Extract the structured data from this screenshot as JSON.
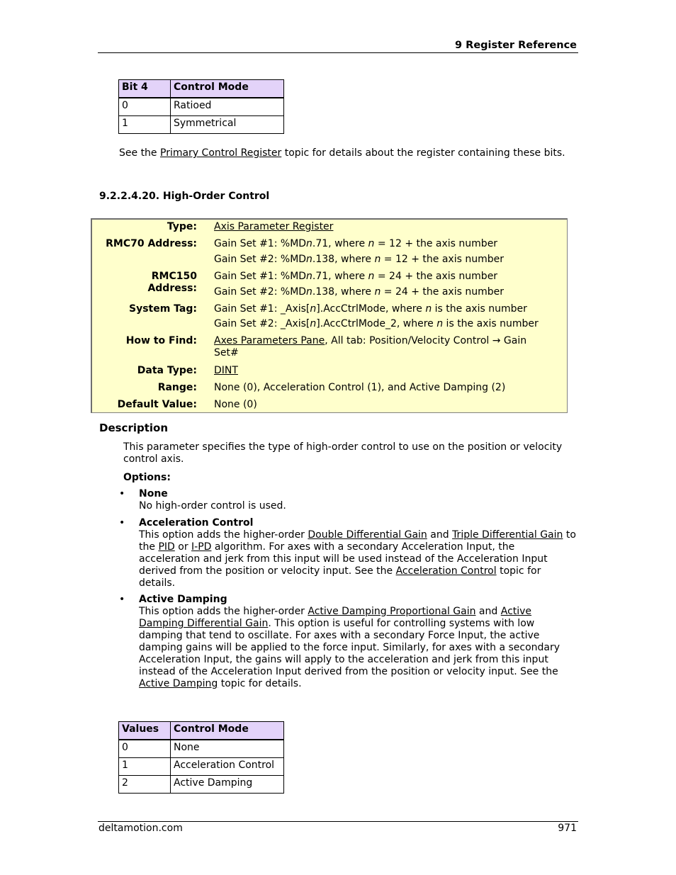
{
  "header": {
    "chapter_title": "9  Register Reference"
  },
  "bit_table": {
    "headers": [
      "Bit 4",
      "Control Mode"
    ],
    "rows": [
      [
        "0",
        "Ratioed"
      ],
      [
        "1",
        "Symmetrical"
      ]
    ]
  },
  "see_note": {
    "prefix": "See the ",
    "link": "Primary Control Register",
    "suffix": " topic for details about the register containing these bits."
  },
  "section": {
    "title": "9.2.2.4.20. High-Order Control"
  },
  "register": {
    "type_label": "Type:",
    "type_value": "Axis Parameter Register",
    "rmc70_label": "RMC70 Address:",
    "rmc70_1": {
      "a": "Gain Set #1: %MD",
      "n": "n",
      "b": ".71, where ",
      "n2": "n",
      "c": " = 12 + the axis number"
    },
    "rmc70_2": {
      "a": "Gain Set #2: %MD",
      "n": "n",
      "b": ".138, where ",
      "n2": "n",
      "c": " = 12 + the axis number"
    },
    "rmc150_label_1": "RMC150",
    "rmc150_label_2": "Address:",
    "rmc150_1": {
      "a": "Gain Set #1: %MD",
      "n": "n",
      "b": ".71, where ",
      "n2": "n",
      "c": " = 24 + the axis number"
    },
    "rmc150_2": {
      "a": "Gain Set #2: %MD",
      "n": "n",
      "b": ".138, where ",
      "n2": "n",
      "c": " = 24 + the axis number"
    },
    "tag_label": "System Tag:",
    "tag_1": {
      "a": "Gain Set #1: _Axis[",
      "n": "n",
      "b": "].AccCtrlMode, where ",
      "n2": "n",
      "c": " is the axis number"
    },
    "tag_2": {
      "a": "Gain Set #2: _Axis[",
      "n": "n",
      "b": "].AccCtrlMode_2, where ",
      "n2": "n",
      "c": " is the axis number"
    },
    "find_label": "How to Find:",
    "find_link": "Axes Parameters Pane",
    "find_rest": ", All tab: Position/Velocity Control → Gain Set#",
    "dtype_label": "Data Type:",
    "dtype_value": "DINT",
    "range_label": "Range:",
    "range_value": "None (0), Acceleration Control (1), and Active Damping (2)",
    "default_label": "Default Value:",
    "default_value": "None (0)"
  },
  "description": {
    "heading": "Description",
    "intro": "This parameter specifies the type of high-order control to use on the position or velocity control axis.",
    "options_heading": "Options:",
    "bullet": "•",
    "none": {
      "title": "None",
      "text": "No high-order control is used."
    },
    "accel": {
      "title": "Acceleration Control",
      "t1": "This option adds the higher-order ",
      "l1": "Double Differential Gain",
      "t2": " and ",
      "l2": "Triple Differential Gain",
      "t3": " to the ",
      "l3": "PID",
      "t4": " or ",
      "l4": "I-PD",
      "t5": " algorithm. For axes with a secondary Acceleration Input, the acceleration and jerk from this input will be used instead of the Acceleration Input derived from the position or velocity input. See the ",
      "l5": "Acceleration Control",
      "t6": " topic for details."
    },
    "damping": {
      "title": "Active Damping",
      "t1": "This option adds the higher-order ",
      "l1": "Active Damping Proportional Gain",
      "t2": " and ",
      "l2": "Active Damping Differential Gain",
      "t3": ". This option is useful for controlling systems with low damping that tend to oscillate. For axes with a secondary Force Input, the active damping gains will be applied to the force input. Similarly, for axes with a secondary Acceleration Input, the gains will apply to the acceleration and jerk from this input instead of the Acceleration Input derived from the position or velocity input. See the ",
      "l3": "Active Damping",
      "t4": " topic for details."
    }
  },
  "values_table": {
    "headers": [
      "Values",
      "Control Mode"
    ],
    "rows": [
      [
        "0",
        "None"
      ],
      [
        "1",
        "Acceleration Control"
      ],
      [
        "2",
        "Active Damping"
      ]
    ]
  },
  "footer": {
    "site": "deltamotion.com",
    "page_number": "971"
  }
}
